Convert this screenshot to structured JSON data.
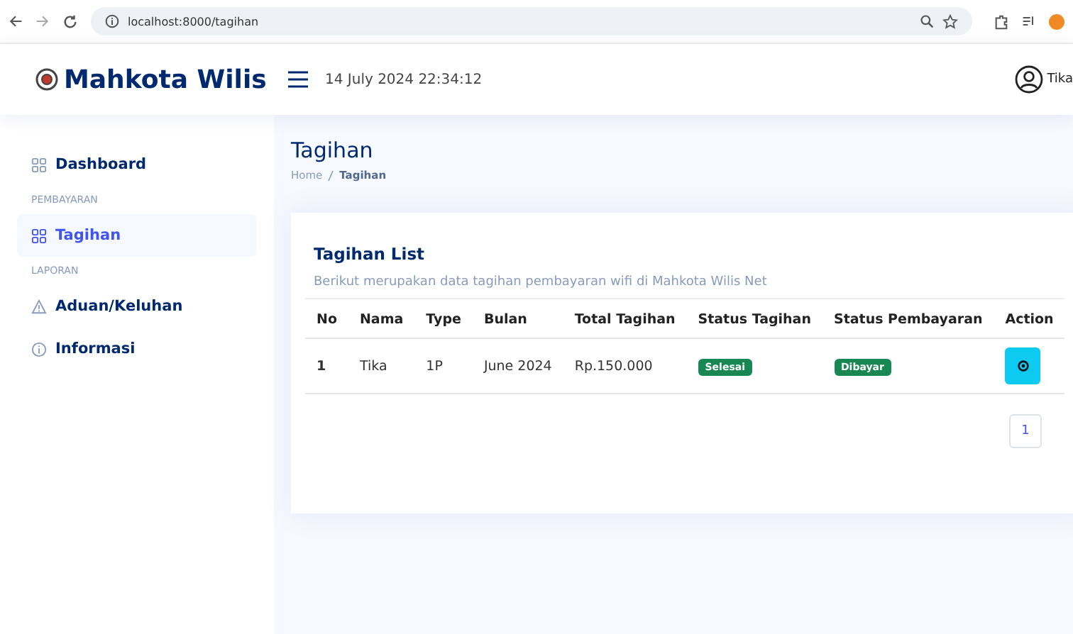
{
  "browser": {
    "url": "localhost:8000/tagihan"
  },
  "header": {
    "brand": "Mahkota Wilis",
    "datetime": "14 July 2024 22:34:12",
    "user": "Tika"
  },
  "sidebar": {
    "items": [
      {
        "kind": "item",
        "label": "Dashboard",
        "selected": false
      },
      {
        "kind": "heading",
        "label": "PEMBAYARAN"
      },
      {
        "kind": "item",
        "label": "Tagihan",
        "selected": true
      },
      {
        "kind": "heading",
        "label": "LAPORAN"
      },
      {
        "kind": "item",
        "label": "Aduan/Keluhan",
        "selected": false
      },
      {
        "kind": "item",
        "label": "Informasi",
        "selected": false
      }
    ]
  },
  "page": {
    "title": "Tagihan",
    "breadcrumb": [
      "Home",
      "Tagihan"
    ]
  },
  "card": {
    "title": "Tagihan List",
    "subtitle": "Berikut merupakan data tagihan pembayaran wifi di Mahkota Wilis Net",
    "table": {
      "columns": [
        "No",
        "Nama",
        "Type",
        "Bulan",
        "Total Tagihan",
        "Status Tagihan",
        "Status Pembayaran",
        "Action"
      ],
      "rows": [
        {
          "no": "1",
          "nama": "Tika",
          "type": "1P",
          "bulan": "June 2024",
          "total": "Rp.150.000",
          "status_tagihan": "Selesai",
          "status_pembayaran": "Dibayar"
        }
      ]
    },
    "pagination": [
      {
        "label": "1",
        "selected": false
      }
    ]
  }
}
